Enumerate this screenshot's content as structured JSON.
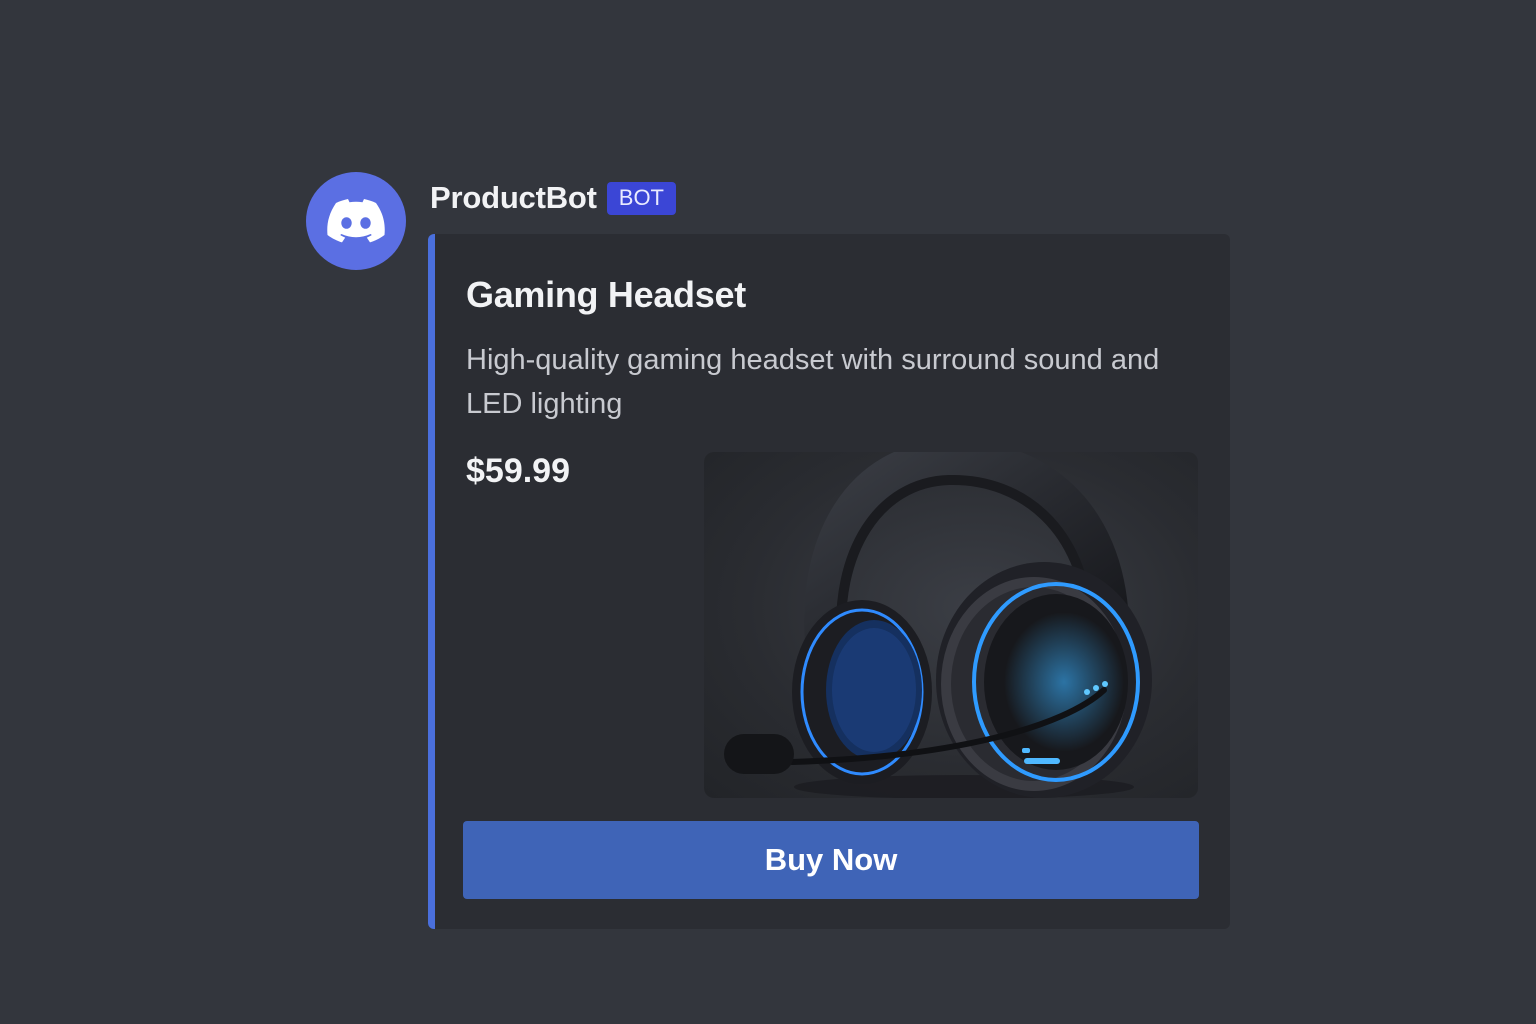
{
  "message": {
    "author": {
      "username": "ProductBot",
      "tag": "BOT",
      "avatar_icon": "discord-logo-icon",
      "avatar_color": "#5b6fe3"
    },
    "embed": {
      "accent_color": "#4a6fdc",
      "title": "Gaming Headset",
      "description": "High-quality gaming headset with surround sound and LED lighting",
      "price": "$59.99",
      "image_icon": "gaming-headset-image",
      "button_label": "Buy Now",
      "button_color": "#3f64b7"
    }
  }
}
